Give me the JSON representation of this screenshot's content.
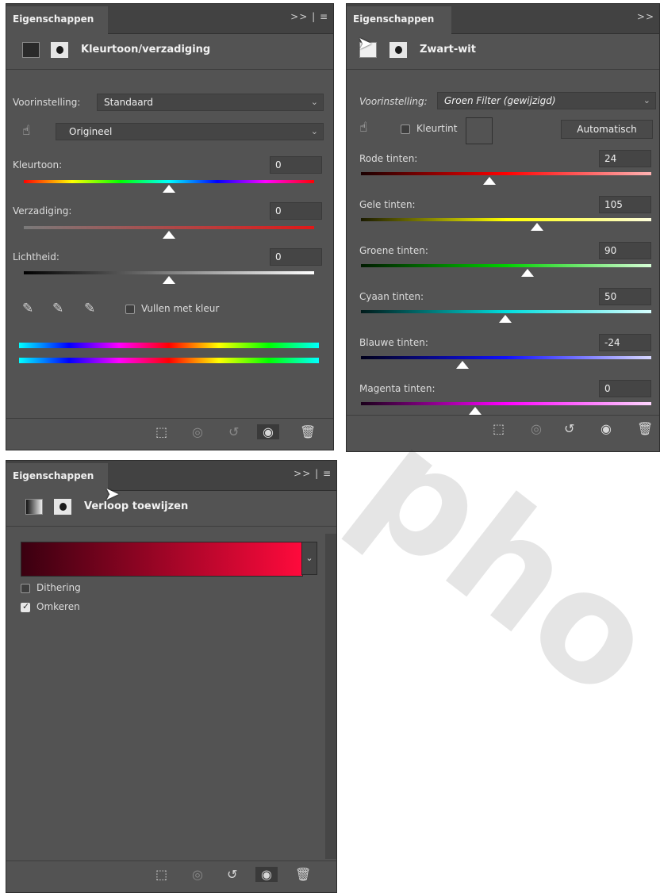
{
  "panel1": {
    "tab": "Eigenschappen",
    "tab_icons": ">> | ≡",
    "title": "Kleurtoon/verzadiging",
    "preset_label": "Voorinstelling:",
    "preset_value": "Standaard",
    "channel_value": "Origineel",
    "hue_label": "Kleurtoon:",
    "hue_value": "0",
    "sat_label": "Verzadiging:",
    "sat_value": "0",
    "light_label": "Lichtheid:",
    "light_value": "0",
    "colorize_label": "Vullen met kleur",
    "colorize_checked": false
  },
  "panel2": {
    "tab": "Eigenschappen",
    "tab_icons": ">>",
    "title": "Zwart-wit",
    "preset_label": "Voorinstelling:",
    "preset_value": "Groen Filter (gewijzigd)",
    "tint_label": "Kleurtint",
    "auto_label": "Automatisch",
    "sliders": [
      {
        "label": "Rode tinten:",
        "value": "24"
      },
      {
        "label": "Gele tinten:",
        "value": "105"
      },
      {
        "label": "Groene tinten:",
        "value": "90"
      },
      {
        "label": "Cyaan tinten:",
        "value": "50"
      },
      {
        "label": "Blauwe tinten:",
        "value": "-24"
      },
      {
        "label": "Magenta tinten:",
        "value": "0"
      }
    ]
  },
  "panel3": {
    "tab": "Eigenschappen",
    "tab_icons": ">> | ≡",
    "title": "Verloop toewijzen",
    "dither_label": "Dithering",
    "dither_checked": false,
    "reverse_label": "Omkeren",
    "reverse_checked": true
  },
  "icons": {
    "clip": "clip-to-layer-icon",
    "view_prev": "view-previous-state-icon",
    "reset": "reset-icon",
    "visibility": "eye-icon",
    "delete": "trash-icon"
  },
  "colors": {
    "panel_bg": "#535353",
    "gradient_start": "#3a0010",
    "gradient_end": "#ff0a3c"
  }
}
